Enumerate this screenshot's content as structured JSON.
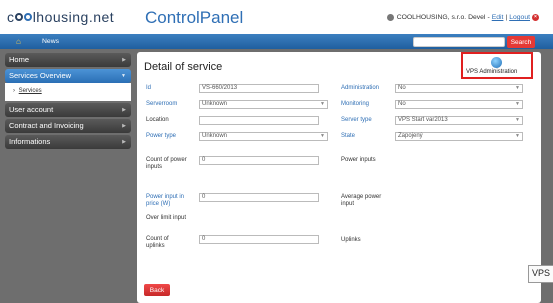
{
  "header": {
    "logo_text_a": "c",
    "logo_text_b": "lhousing.net",
    "app_title": "ControlPanel",
    "user_name": "COOLHOUSING, s.r.o. Devel",
    "edit_link": "Edit",
    "logout_link": "Logout",
    "separator": "-",
    "pipe": "|"
  },
  "navbar": {
    "news_label": "News",
    "search_placeholder": "",
    "search_button": "Search"
  },
  "sidebar": {
    "items": [
      {
        "label": "Home"
      },
      {
        "label": "Services Overview"
      },
      {
        "label": "User account"
      },
      {
        "label": "Contract and Invoicing"
      },
      {
        "label": "Informations"
      }
    ],
    "sub_item": "Services"
  },
  "main": {
    "title": "Detail of service",
    "vps_admin_label": "VPS Administration",
    "fields": {
      "id_label": "Id",
      "id_value": "VS-660/2013",
      "administration_label": "Administration",
      "administration_value": "No",
      "serverroom_label": "Serverroom",
      "serverroom_value": "Unknown",
      "monitoring_label": "Monitoring",
      "monitoring_value": "No",
      "location_label": "Location",
      "location_value": "",
      "server_type_label": "Server type",
      "server_type_value": "VPS Start var2013",
      "power_type_label": "Power type",
      "power_type_value": "Unknown",
      "state_label": "State",
      "state_value": "Zapojený",
      "count_power_inputs_label": "Count of power inputs",
      "count_power_inputs_value": "0",
      "power_inputs_label": "Power inputs",
      "power_input_price_label": "Power input in price (W)",
      "power_input_price_value": "0",
      "avg_power_input_label": "Average power input",
      "over_limit_label": "Over limit input",
      "count_uplinks_label": "Count of uplinks",
      "count_uplinks_value": "0",
      "uplinks_label": "Uplinks"
    },
    "back_button": "Back"
  },
  "tooltip": {
    "text": "VPS"
  },
  "colors": {
    "accent": "#2f6fb5",
    "danger": "#e53935",
    "sidebar_active": "#3a84c9"
  }
}
